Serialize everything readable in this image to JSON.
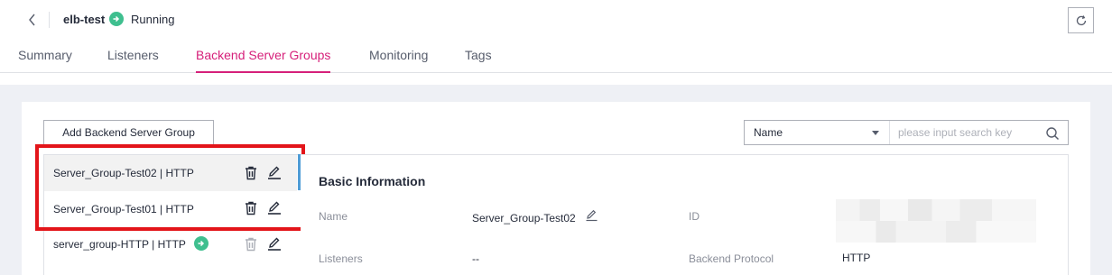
{
  "header": {
    "elb_name": "elb-test",
    "status": "Running",
    "status_color": "#3fbf8f"
  },
  "tabs": [
    {
      "label": "Summary",
      "active": false
    },
    {
      "label": "Listeners",
      "active": false
    },
    {
      "label": "Backend Server Groups",
      "active": true
    },
    {
      "label": "Monitoring",
      "active": false
    },
    {
      "label": "Tags",
      "active": false
    }
  ],
  "accent_color": "#d6207a",
  "toolbar": {
    "add_button_label": "Add Backend Server Group"
  },
  "search": {
    "select_value": "Name",
    "placeholder": "please input search key"
  },
  "server_groups": [
    {
      "label": "Server_Group-Test02 | HTTP",
      "selected": true
    },
    {
      "label": "Server_Group-Test01 | HTTP",
      "selected": false
    },
    {
      "label": "server_group-HTTP | HTTP",
      "selected": false
    }
  ],
  "basic_info": {
    "title": "Basic Information",
    "name_label": "Name",
    "name_value": "Server_Group-Test02",
    "id_label": "ID",
    "listeners_label": "Listeners",
    "listeners_value": "--",
    "backend_protocol_label": "Backend Protocol",
    "backend_protocol_value": "HTTP"
  },
  "icons": {
    "back": "chevron-left-icon",
    "status": "check-circle-icon",
    "refresh": "refresh-icon",
    "caret": "caret-down-icon",
    "search": "search-icon",
    "delete": "trash-icon",
    "edit": "edit-pencil-icon",
    "associated": "arrow-circle-icon"
  }
}
